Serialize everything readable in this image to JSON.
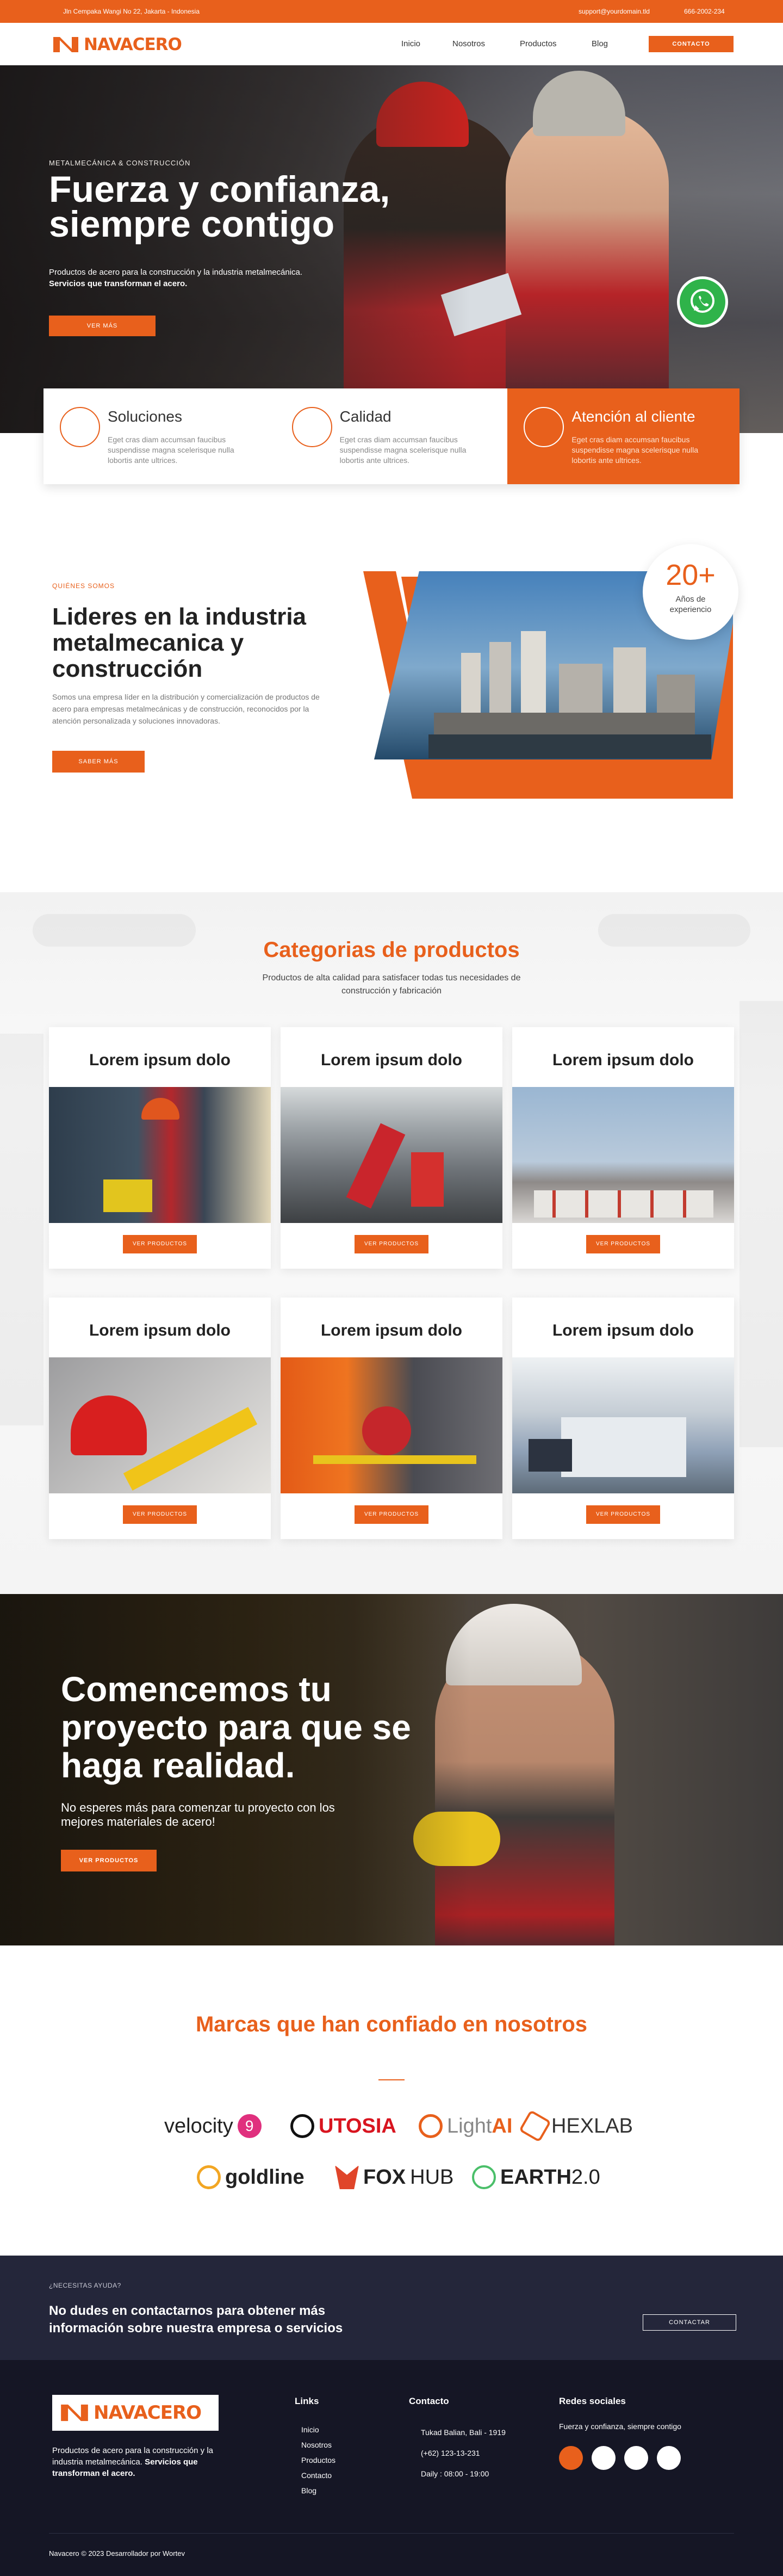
{
  "topbar": {
    "address": "Jln Cempaka Wangi No 22, Jakarta - Indonesia",
    "email": "support@yourdomain.tld",
    "phone": "666-2002-234"
  },
  "brand": {
    "name": "NAVACERO",
    "color": "#e8601c"
  },
  "nav": {
    "items": [
      "Inicio",
      "Nosotros",
      "Productos",
      "Blog"
    ],
    "cta": "CONTACTO"
  },
  "hero": {
    "kicker": "METALMECÁNICA & CONSTRUCCIÓN",
    "title": "Fuerza y confianza, siempre contigo",
    "subtitle": "Productos de acero para la construcción y la industria metalmecánica.",
    "subtitle_bold": "Servicios que transforman el acero.",
    "button": "VER MÁS",
    "whatsapp_icon": "whatsapp-icon"
  },
  "features": [
    {
      "title": "Soluciones",
      "text": "Eget cras diam accumsan faucibus suspendisse magna scelerisque nulla lobortis ante ultrices.",
      "active": false
    },
    {
      "title": "Calidad",
      "text": "Eget cras diam accumsan faucibus suspendisse magna scelerisque nulla lobortis ante ultrices.",
      "active": false
    },
    {
      "title": "Atención al cliente",
      "text": "Eget cras diam accumsan faucibus suspendisse magna scelerisque nulla lobortis ante ultrices.",
      "active": true
    }
  ],
  "about": {
    "kicker": "QUIÉNES SOMOS",
    "title": "Lideres en la industria metalmecanica y construcción",
    "text": "Somos una empresa líder en la distribución y comercialización de productos de acero para empresas metalmecánicas y de construcción, reconocidos por la atención personalizada y soluciones innovadoras.",
    "button": "SABER MÁS",
    "badge_number": "20+",
    "badge_label": "Años de experiencio"
  },
  "products": {
    "title": "Categorias de productos",
    "description": "Productos de alta calidad para satisfacer todas tus necesidades de construcción y fabricación",
    "cards": [
      {
        "title": "Lorem ipsum dolo",
        "button": "VER PRODUCTOS"
      },
      {
        "title": "Lorem ipsum dolo",
        "button": "VER PRODUCTOS"
      },
      {
        "title": "Lorem ipsum dolo",
        "button": "VER PRODUCTOS"
      },
      {
        "title": "Lorem ipsum dolo",
        "button": "VER PRODUCTOS"
      },
      {
        "title": "Lorem ipsum dolo",
        "button": "VER PRODUCTOS"
      },
      {
        "title": "Lorem ipsum dolo",
        "button": "VER PRODUCTOS"
      }
    ]
  },
  "banner": {
    "title": "Comencemos tu proyecto para que se haga realidad.",
    "text": "No esperes más para comenzar tu proyecto con los mejores materiales de acero!",
    "button": "VER PRODUCTOS"
  },
  "brands": {
    "title": "Marcas que han confiado en nosotros",
    "logos": [
      {
        "name": "velocity",
        "suffix": "9",
        "icon_color": "#e0307e"
      },
      {
        "name": "UTOSIA",
        "suffix": "",
        "icon_color": "#d8141f"
      },
      {
        "name": "Light",
        "suffix": "AI",
        "icon_color": "#e8601c"
      },
      {
        "name": "HEXLAB",
        "suffix": "",
        "icon_color": "#e8601c"
      },
      {
        "name": "goldline",
        "suffix": "",
        "icon_color": "#f2a623"
      },
      {
        "name": "FOX",
        "suffix": "HUB",
        "icon_color": "#e0452a"
      },
      {
        "name": "EARTH",
        "suffix": "2.0",
        "icon_color": "#4bbf6a"
      }
    ]
  },
  "help": {
    "kicker": "¿NECESITAS AYUDA?",
    "title": "No dudes en contactarnos para obtener más información sobre nuestra empresa o servicios",
    "button": "CONTACTAR"
  },
  "footer": {
    "about": "Productos de acero para la construcción y la industria metalmecánica.",
    "about_bold": "Servicios que transforman el acero.",
    "links_title": "Links",
    "links": [
      "Inicio",
      "Nosotros",
      "Productos",
      "Contacto",
      "Blog"
    ],
    "contact_title": "Contacto",
    "contact": [
      "Tukad Balian, Bali - 1919",
      "(+62) 123-13-231",
      "Daily : 08:00 - 19:00"
    ],
    "social_title": "Redes sociales",
    "social_text": "Fuerza y confianza, siempre contigo",
    "copyright": "Navacero © 2023 Desarrollador por Wortev"
  }
}
